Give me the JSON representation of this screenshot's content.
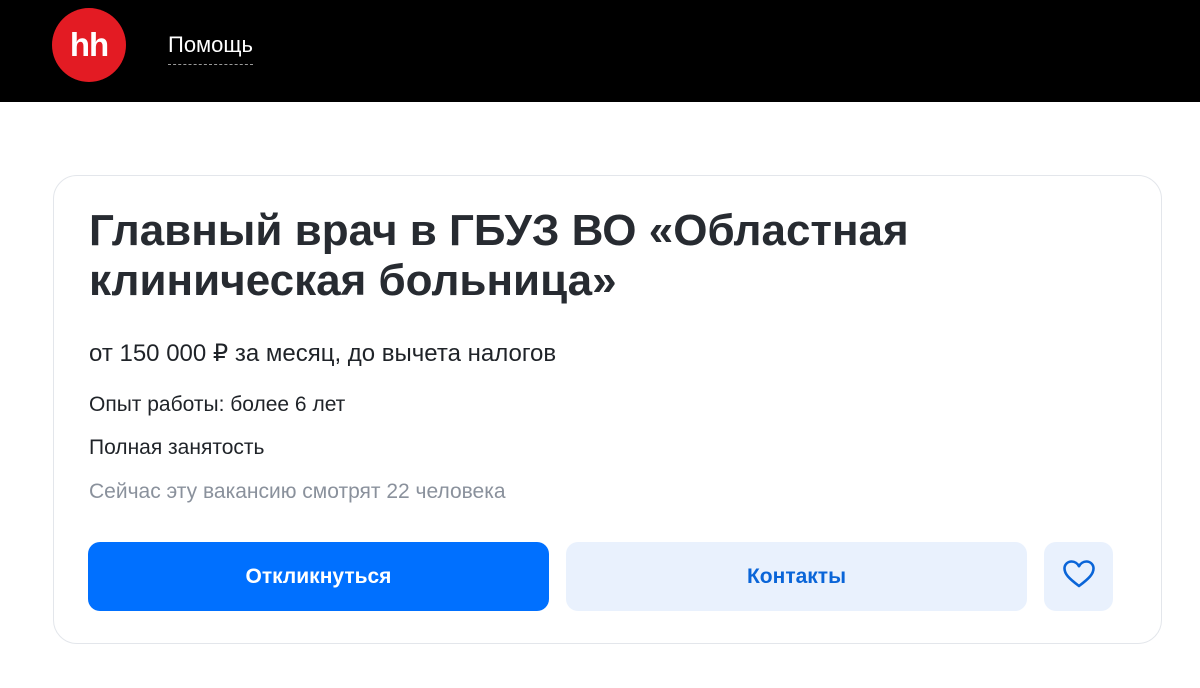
{
  "header": {
    "logo_text": "hh",
    "help_label": "Помощь",
    "colors": {
      "bar": "#000000",
      "logo": "#e31b23"
    }
  },
  "vacancy": {
    "title": "Главный врач в ГБУЗ ВО «Областная клиническая больница»",
    "salary": "от 150 000 ₽ за месяц, до вычета налогов",
    "experience": "Опыт работы: более 6 лет",
    "employment": "Полная занятость",
    "viewers": "Сейчас эту вакансию смотрят 22 человека"
  },
  "actions": {
    "respond_label": "Откликнуться",
    "contacts_label": "Контакты",
    "favorite_icon": "heart-icon",
    "colors": {
      "primary": "#0070ff",
      "secondary_bg": "#e9f1fd",
      "secondary_text": "#0a65d8"
    }
  }
}
